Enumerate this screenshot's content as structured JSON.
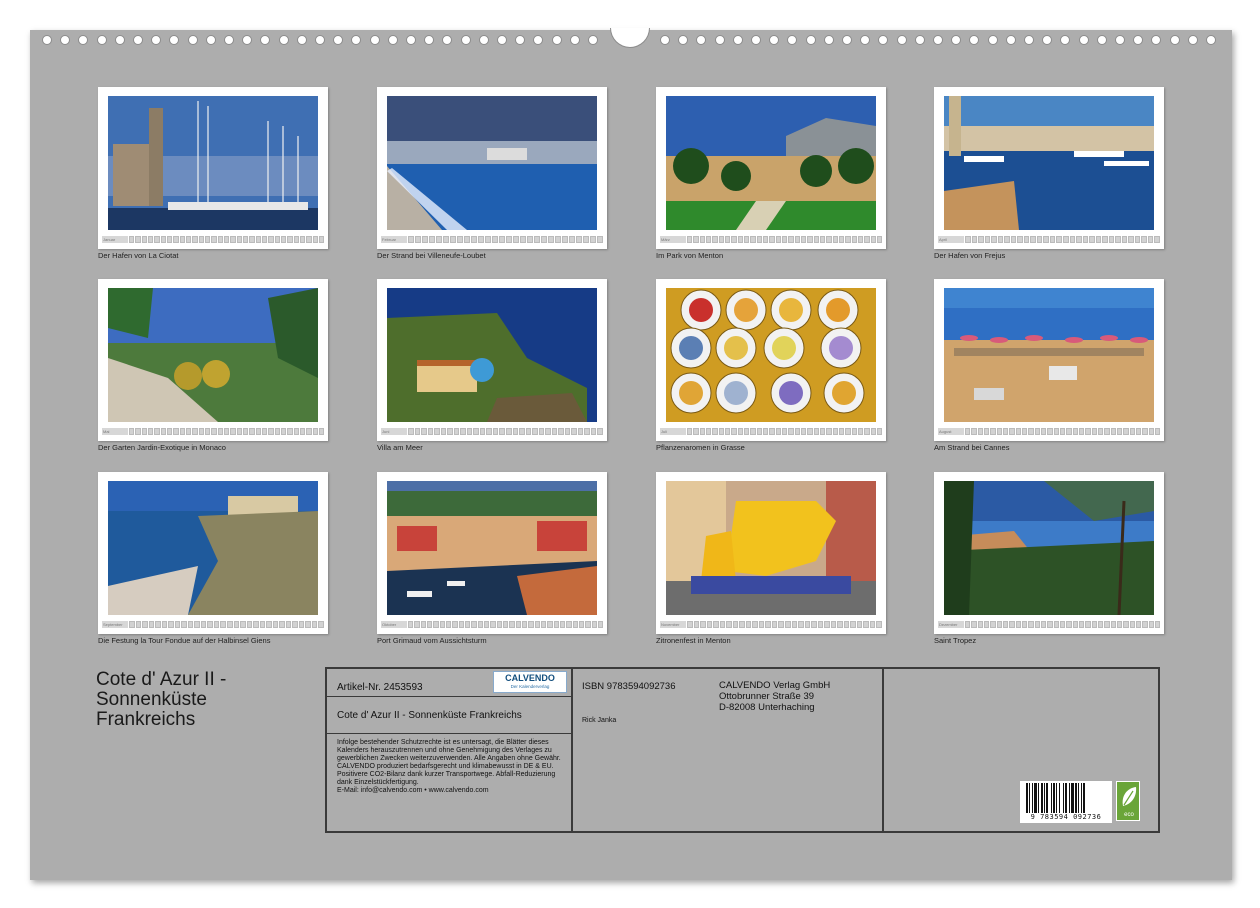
{
  "calendar": {
    "title": "Cote d' Azur II - Sonnenküste Frankreichs",
    "months": [
      {
        "key": "jan",
        "strip_label": "Januar",
        "caption": "Der Hafen von La Ciotat",
        "days": 31
      },
      {
        "key": "feb",
        "strip_label": "Februar",
        "caption": "Der Strand bei Villeneufe-Loubet",
        "days": 28
      },
      {
        "key": "mar",
        "strip_label": "März",
        "caption": "Im Park von Menton",
        "days": 31
      },
      {
        "key": "apr",
        "strip_label": "April",
        "caption": "Der Hafen von Frejus",
        "days": 30
      },
      {
        "key": "may",
        "strip_label": "Mai",
        "caption": "Der Garten Jardin-Exotique in Monaco",
        "days": 31
      },
      {
        "key": "jun",
        "strip_label": "Juni",
        "caption": "Villa am Meer",
        "days": 30
      },
      {
        "key": "jul",
        "strip_label": "Juli",
        "caption": "Pflanzenaromen in Grasse",
        "days": 31
      },
      {
        "key": "aug",
        "strip_label": "August",
        "caption": "Am Strand bei Cannes",
        "days": 31
      },
      {
        "key": "sep",
        "strip_label": "September",
        "caption": "Die Festung la Tour Fondue auf der Halbinsel Giens",
        "days": 30
      },
      {
        "key": "oct",
        "strip_label": "Oktober",
        "caption": "Port Grimaud vom Aussichtsturm",
        "days": 31
      },
      {
        "key": "nov",
        "strip_label": "November",
        "caption": "Zitronenfest in Menton",
        "days": 30
      },
      {
        "key": "dec",
        "strip_label": "Dezember",
        "caption": "Saint Tropez",
        "days": 31
      }
    ]
  },
  "cover": {
    "title_line1": "Cote d' Azur II -",
    "title_line2": "Sonnenküste",
    "title_line3": "Frankreichs"
  },
  "info": {
    "article_number": "Artikel-Nr. 2453593",
    "logo_main": "CALVENDO",
    "logo_sub": "Der Kalenderverlag",
    "title_line": "Cote d' Azur II - Sonnenküste Frankreichs",
    "legal_text": "Infolge bestehender Schutzrechte ist es untersagt, die Blätter dieses Kalenders herauszutrennen und ohne Genehmigung des Verlages zu gewerblichen Zwecken weiterzuverwenden. Alle Angaben ohne Gewähr. CALVENDO produziert bedarfsgerecht und klimabewusst in DE & EU. Positivere CO2-Bilanz dank kurzer Transportwege. Abfall-Reduzierung dank Einzelstückfertigung.",
    "legal_contact": "E-Mail: info@calvendo.com • www.calvendo.com",
    "isbn": "ISBN 9783594092736",
    "author": "Rick Janka",
    "publisher_name": "CALVENDO Verlag GmbH",
    "publisher_street": "Ottobrunner Straße 39",
    "publisher_city": "D-82008 Unterhaching",
    "barcode_number": "9 783594 092736",
    "eco_label": "eco"
  },
  "colors": {
    "page_bg": "#adadad",
    "frame": "#3a3a3a",
    "eco_green": "#6aa539",
    "logo_blue": "#134f7e"
  }
}
